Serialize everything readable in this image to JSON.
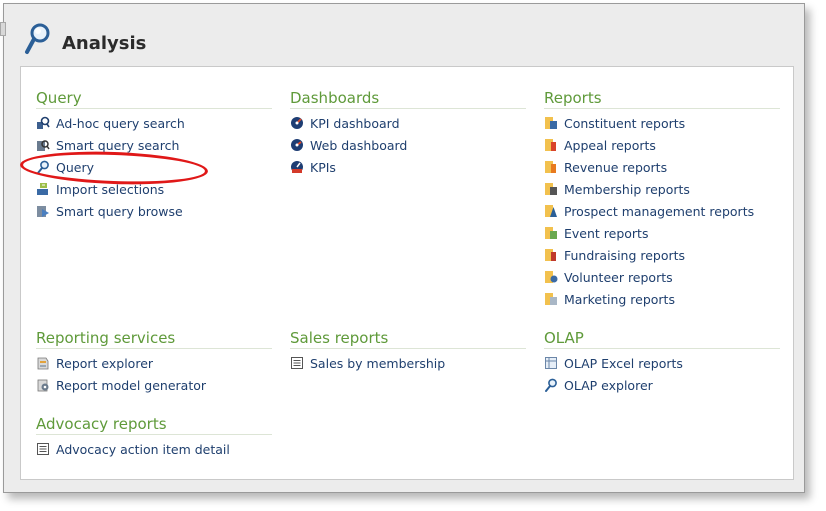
{
  "page": {
    "title": "Analysis"
  },
  "colors": {
    "section_title": "#5f9a3a",
    "link": "#1f3f6e",
    "highlight": "#e01818"
  },
  "sections": {
    "query": {
      "title": "Query",
      "items": [
        {
          "label": "Ad-hoc query search",
          "icon": "adhoc-search-icon"
        },
        {
          "label": "Smart query search",
          "icon": "smart-query-search-icon"
        },
        {
          "label": "Query",
          "icon": "query-magnifier-icon"
        },
        {
          "label": "Import selections",
          "icon": "import-selections-icon"
        },
        {
          "label": "Smart query browse",
          "icon": "smart-query-browse-icon"
        }
      ]
    },
    "dashboards": {
      "title": "Dashboards",
      "items": [
        {
          "label": "KPI dashboard",
          "icon": "kpi-dashboard-icon"
        },
        {
          "label": "Web dashboard",
          "icon": "web-dashboard-icon"
        },
        {
          "label": "KPIs",
          "icon": "kpis-icon"
        }
      ]
    },
    "reports": {
      "title": "Reports",
      "items": [
        {
          "label": "Constituent reports",
          "icon": "report-icon"
        },
        {
          "label": "Appeal reports",
          "icon": "report-icon"
        },
        {
          "label": "Revenue reports",
          "icon": "report-icon"
        },
        {
          "label": "Membership reports",
          "icon": "report-icon"
        },
        {
          "label": "Prospect management reports",
          "icon": "report-icon"
        },
        {
          "label": "Event reports",
          "icon": "report-icon"
        },
        {
          "label": "Fundraising reports",
          "icon": "report-icon"
        },
        {
          "label": "Volunteer reports",
          "icon": "report-icon"
        },
        {
          "label": "Marketing reports",
          "icon": "report-icon"
        }
      ]
    },
    "reporting_services": {
      "title": "Reporting services",
      "items": [
        {
          "label": "Report explorer",
          "icon": "report-explorer-icon"
        },
        {
          "label": "Report model generator",
          "icon": "report-model-generator-icon"
        }
      ]
    },
    "sales_reports": {
      "title": "Sales reports",
      "items": [
        {
          "label": "Sales by membership",
          "icon": "list-report-icon"
        }
      ]
    },
    "olap": {
      "title": "OLAP",
      "items": [
        {
          "label": "OLAP Excel reports",
          "icon": "olap-excel-icon"
        },
        {
          "label": "OLAP explorer",
          "icon": "olap-explorer-icon"
        }
      ]
    },
    "advocacy_reports": {
      "title": "Advocacy reports",
      "items": [
        {
          "label": "Advocacy action item detail",
          "icon": "list-report-icon"
        }
      ]
    }
  }
}
